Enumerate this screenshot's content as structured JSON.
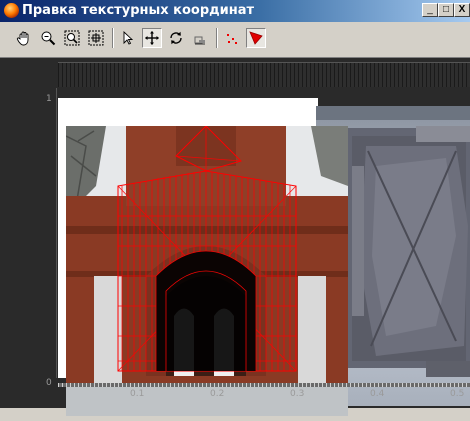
{
  "window": {
    "title": "Правка текстурных координат",
    "controls": {
      "minimize": "_",
      "maximize": "□",
      "close": "X"
    }
  },
  "toolbar": {
    "tools": [
      {
        "name": "pan-hand-icon",
        "active": false
      },
      {
        "name": "zoom-icon",
        "active": false
      },
      {
        "name": "zoom-window-icon",
        "active": false
      },
      {
        "name": "zoom-extents-icon",
        "active": false
      },
      {
        "name": "select-arrow-icon",
        "active": false
      },
      {
        "name": "move-icon",
        "active": true
      },
      {
        "name": "rotate-icon",
        "active": false
      },
      {
        "name": "scale-icon",
        "active": false
      },
      {
        "name": "vertex-points-icon",
        "active": false
      },
      {
        "name": "triangle-selection-icon",
        "active": true
      }
    ]
  },
  "rulers": {
    "x_ticks": [
      "0.1",
      "0.2",
      "0.3",
      "0.4",
      "0.5"
    ],
    "y_ticks": [
      "1",
      "0"
    ]
  },
  "colors": {
    "wireframe": "#ff0000",
    "brick": "#8a3a24",
    "canvas_bg": "#2a2a2a"
  }
}
